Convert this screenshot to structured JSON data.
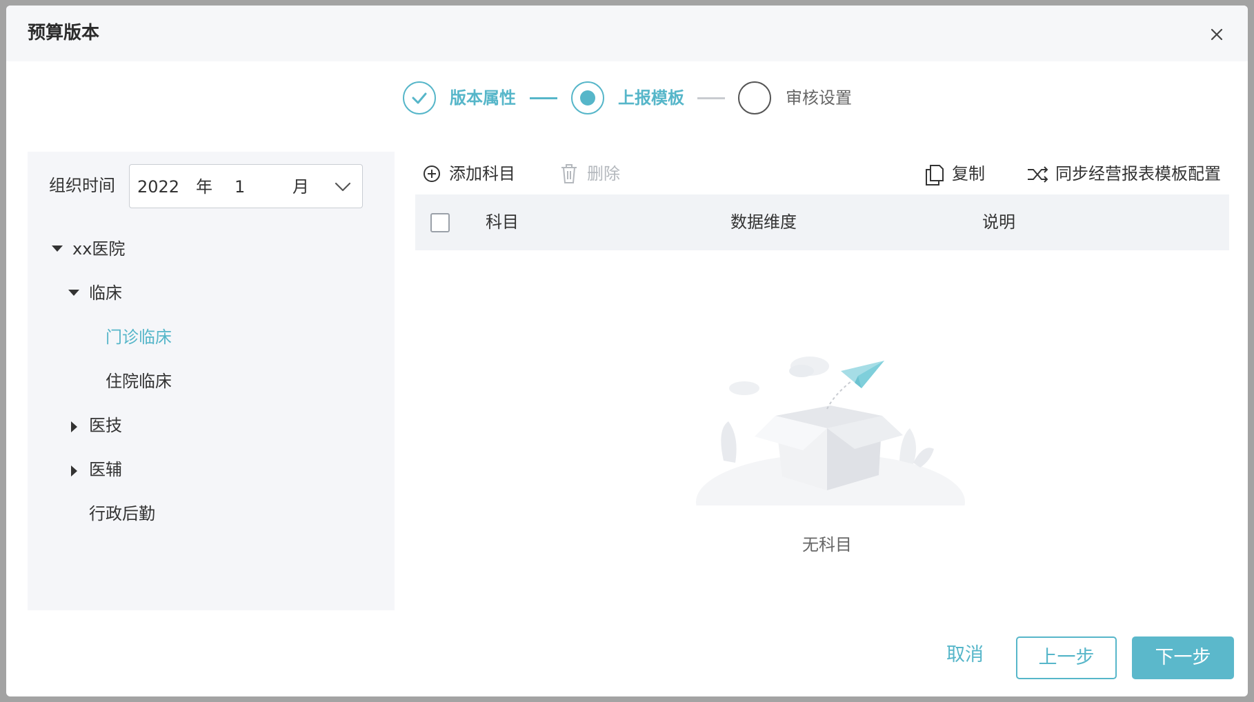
{
  "modal": {
    "title": "预算版本"
  },
  "steps": [
    {
      "label": "版本属性",
      "state": "done"
    },
    {
      "label": "上报模板",
      "state": "current"
    },
    {
      "label": "审核设置",
      "state": "pending"
    }
  ],
  "filter": {
    "label": "组织时间",
    "year": "2022",
    "year_unit": "年",
    "month": "1",
    "month_unit": "月"
  },
  "tree": {
    "root": {
      "label": "xx医院",
      "expanded": true
    },
    "clinical": {
      "label": "临床",
      "expanded": true
    },
    "outpatient": {
      "label": "门诊临床",
      "selected": true
    },
    "inpatient": {
      "label": "住院临床"
    },
    "medtech": {
      "label": "医技",
      "expanded": false
    },
    "auxiliary": {
      "label": "医辅",
      "expanded": false
    },
    "admin": {
      "label": "行政后勤"
    }
  },
  "toolbar": {
    "add_label": "添加科目",
    "delete_label": "删除",
    "copy_label": "复制",
    "sync_label": "同步经营报表模板配置"
  },
  "table": {
    "columns": [
      "科目",
      "数据维度",
      "说明"
    ]
  },
  "empty": {
    "text": "无科目"
  },
  "footer": {
    "cancel_label": "取消",
    "prev_label": "上一步",
    "next_label": "下一步"
  },
  "colors": {
    "accent": "#56b6c9",
    "primary_button": "#5bb8cb",
    "disabled_text": "#b4b8bd"
  }
}
